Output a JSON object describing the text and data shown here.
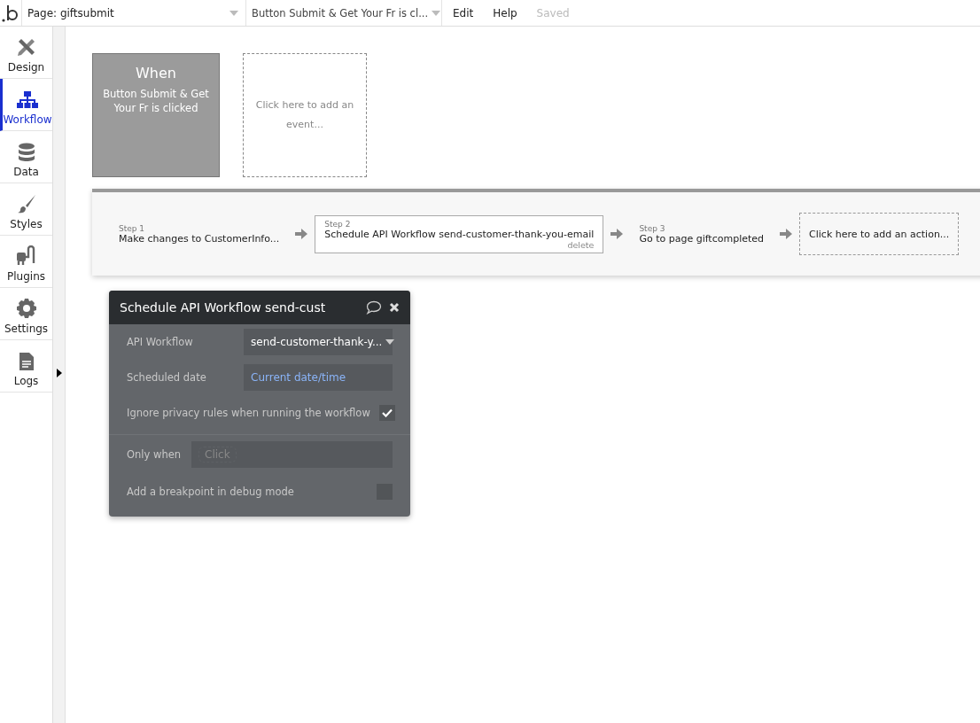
{
  "topbar": {
    "page": "Page: giftsubmit",
    "event": "Button Submit & Get Your Fr is cl...",
    "menu": [
      "Edit",
      "Help"
    ],
    "status": "Saved"
  },
  "sidebar": {
    "items": [
      {
        "label": "Design",
        "kind": "design",
        "selected": false
      },
      {
        "label": "Workflow",
        "kind": "workflow",
        "selected": true
      },
      {
        "label": "Data",
        "kind": "data",
        "selected": false
      },
      {
        "label": "Styles",
        "kind": "styles",
        "selected": false
      },
      {
        "label": "Plugins",
        "kind": "plugins",
        "selected": false
      },
      {
        "label": "Settings",
        "kind": "settings",
        "selected": false
      },
      {
        "label": "Logs",
        "kind": "logs",
        "selected": false
      }
    ]
  },
  "event": {
    "heading": "When",
    "text": "Button Submit & Get Your Fr is clicked"
  },
  "add_event": "Click here to add an event...",
  "steps": [
    {
      "step": "Step 1",
      "text": "Make changes to CustomerInfo...",
      "selected": false
    },
    {
      "step": "Step 2",
      "text": "Schedule API Workflow send-customer-thank-you-email",
      "selected": true,
      "delete": "delete"
    },
    {
      "step": "Step 3",
      "text": "Go to page giftcompleted",
      "selected": false
    }
  ],
  "add_action": "Click here to add an action...",
  "panel": {
    "title": "Schedule API Workflow send-cust",
    "rows": [
      {
        "kind": "dropdown",
        "label": "API Workflow",
        "value": "send-customer-thank-y..."
      },
      {
        "kind": "expression",
        "label": "Scheduled date",
        "value": "Current date/time"
      },
      {
        "kind": "checkbox",
        "label": "Ignore privacy rules when running the workflow",
        "checked": true
      },
      {
        "kind": "condition",
        "label": "Only when",
        "placeholder": "Click"
      },
      {
        "kind": "checkbox",
        "label": "Add a breakpoint in debug mode",
        "checked": false
      }
    ]
  }
}
